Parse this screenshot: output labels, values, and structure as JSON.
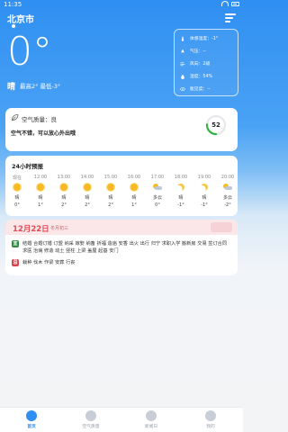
{
  "status_bar": {
    "time": "11:35"
  },
  "header": {
    "city": "北京市"
  },
  "current": {
    "temp": "0°",
    "condition": "晴",
    "minmax": "最高2° 最低-3°"
  },
  "details": [
    {
      "icon": "thermometer-icon",
      "text": "体感温度：-1°"
    },
    {
      "icon": "pressure-icon",
      "text": "气压：--"
    },
    {
      "icon": "wind-icon",
      "text": "风向：2级"
    },
    {
      "icon": "humidity-icon",
      "text": "湿度：54%"
    },
    {
      "icon": "visibility-icon",
      "text": "能见度：--"
    }
  ],
  "aqi": {
    "title": "空气质量：良",
    "desc": "空气不错，可以放心外出哦",
    "value": "52",
    "fraction": 0.26,
    "color": "#2fb344"
  },
  "hourly": {
    "title": "24小时预报",
    "items": [
      {
        "time": "现在",
        "icon": "sun",
        "cond": "晴",
        "temp": "0°"
      },
      {
        "time": "12:00",
        "icon": "sun",
        "cond": "晴",
        "temp": "1°"
      },
      {
        "time": "13:00",
        "icon": "sun",
        "cond": "晴",
        "temp": "2°"
      },
      {
        "time": "14:00",
        "icon": "sun",
        "cond": "晴",
        "temp": "2°"
      },
      {
        "time": "15:00",
        "icon": "sun",
        "cond": "晴",
        "temp": "2°"
      },
      {
        "time": "16:00",
        "icon": "sun",
        "cond": "晴",
        "temp": "1°"
      },
      {
        "time": "17:00",
        "icon": "cloudy",
        "cond": "多云",
        "temp": "0°"
      },
      {
        "time": "18:00",
        "icon": "moon",
        "cond": "晴",
        "temp": "-1°"
      },
      {
        "time": "19:00",
        "icon": "moon",
        "cond": "晴",
        "temp": "-1°"
      },
      {
        "time": "20:00",
        "icon": "cloudy",
        "cond": "多云",
        "temp": "-2°"
      }
    ]
  },
  "almanac": {
    "date": "12月22日",
    "lunar": "冬月初三",
    "yi_label": "宜",
    "yi": "结婚 合婚订婚 订盟 纳采 嫁娶 纳畜 祈福 造庙 安香 出火 出行 归宁 求职入学 搬新房 交易 签订合同 求医 治病 修造 动土 竖柱 上梁 盖屋 起基 安门",
    "ji_label": "忌",
    "ji": "栽种 伐木 作梁 安葬 行丧"
  },
  "nav": [
    {
      "label": "首页",
      "active": true
    },
    {
      "label": "空气质量",
      "active": false
    },
    {
      "label": "新闻日",
      "active": false
    },
    {
      "label": "我的",
      "active": false
    }
  ],
  "colors": {
    "primary": "#2f8ff2",
    "almanac_red": "#e34b57",
    "yi_green": "#2e8b3e"
  }
}
